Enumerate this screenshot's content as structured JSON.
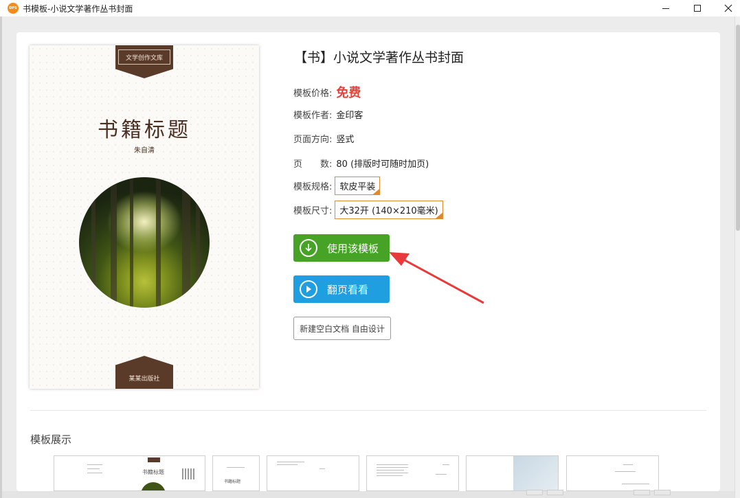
{
  "window": {
    "app_icon_text": "DPS",
    "title": "书模板-小说文学著作丛书封面",
    "controls": {
      "minimize": "minimize-icon",
      "maximize": "maximize-icon",
      "close": "close-icon"
    }
  },
  "cover": {
    "series_label": "文学创作文库",
    "book_title": "书籍标题",
    "author": "朱自清",
    "publisher": "某某出版社"
  },
  "template": {
    "title": "【书】小说文学著作丛书封面",
    "price_label": "模板价格:",
    "price_value": "免费",
    "author_label": "模板作者:",
    "author_value": "金印客",
    "orientation_label": "页面方向:",
    "orientation_value": "竖式",
    "pages_label": "页　　数:",
    "pages_value": "80 (排版时可随时加页)",
    "spec_label": "模板规格:",
    "spec_value": "软皮平装",
    "size_label": "模板尺寸:",
    "size_value": "大32开 (140×210毫米)"
  },
  "actions": {
    "use_template": "使用该模板",
    "flip_preview": "翻页看看",
    "new_blank": "新建空白文档 自由设计"
  },
  "showcase": {
    "title": "模板展示",
    "thumb_title": "书籍标题"
  },
  "colors": {
    "price": "#e8413a",
    "use_button": "#46a325",
    "flip_button": "#1f9ee0",
    "spec_border": "#e08a2b",
    "cover_brown": "#5a3a28",
    "arrow": "#e83a3a"
  }
}
